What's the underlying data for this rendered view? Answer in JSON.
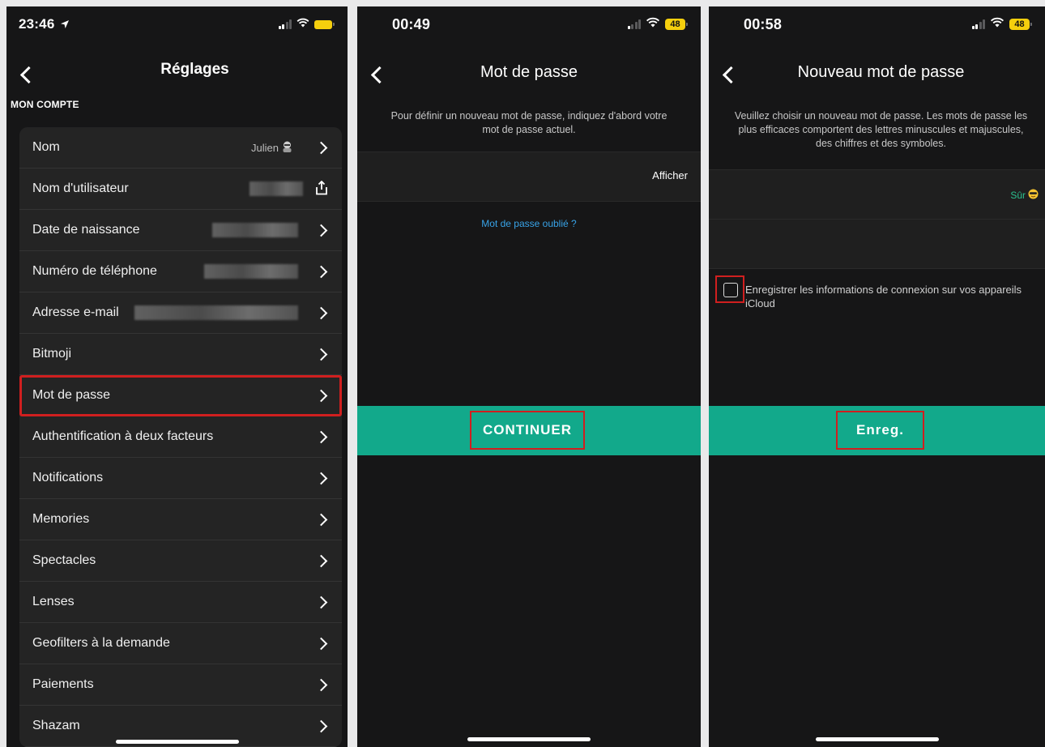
{
  "phone1": {
    "time": "23:46",
    "title": "Réglages",
    "section": "MON COMPTE",
    "rows": [
      {
        "label": "Nom",
        "value": "Julien"
      },
      {
        "label": "Nom d'utilisateur"
      },
      {
        "label": "Date de naissance"
      },
      {
        "label": "Numéro de téléphone"
      },
      {
        "label": "Adresse e-mail"
      },
      {
        "label": "Bitmoji"
      },
      {
        "label": "Mot de passe"
      },
      {
        "label": "Authentification à deux facteurs"
      },
      {
        "label": "Notifications"
      },
      {
        "label": "Memories"
      },
      {
        "label": "Spectacles"
      },
      {
        "label": "Lenses"
      },
      {
        "label": "Geofilters à la demande"
      },
      {
        "label": "Paiements"
      },
      {
        "label": "Shazam"
      }
    ]
  },
  "phone2": {
    "time": "00:49",
    "battery": "48",
    "title": "Mot de passe",
    "description": "Pour définir un nouveau mot de passe, indiquez d'abord votre mot de passe actuel.",
    "show_label": "Afficher",
    "forgot_link": "Mot de passe oublié ?",
    "continue_button": "CONTINUER"
  },
  "phone3": {
    "time": "00:58",
    "battery": "48",
    "title": "Nouveau mot de passe",
    "description": "Veuillez choisir un nouveau mot de passe. Les mots de passe les plus efficaces comportent des lettres minuscules et majuscules, des chiffres et des symboles.",
    "strength": "Sûr",
    "checkbox_label": "Enregistrer les informations de connexion sur vos appareils iCloud",
    "save_button": "Enreg."
  },
  "colors": {
    "background": "#161617",
    "accent_green": "#12a98b",
    "highlight_red": "#d01f1f",
    "link_blue": "#38a3e8",
    "battery_yellow": "#f5cf0d"
  }
}
